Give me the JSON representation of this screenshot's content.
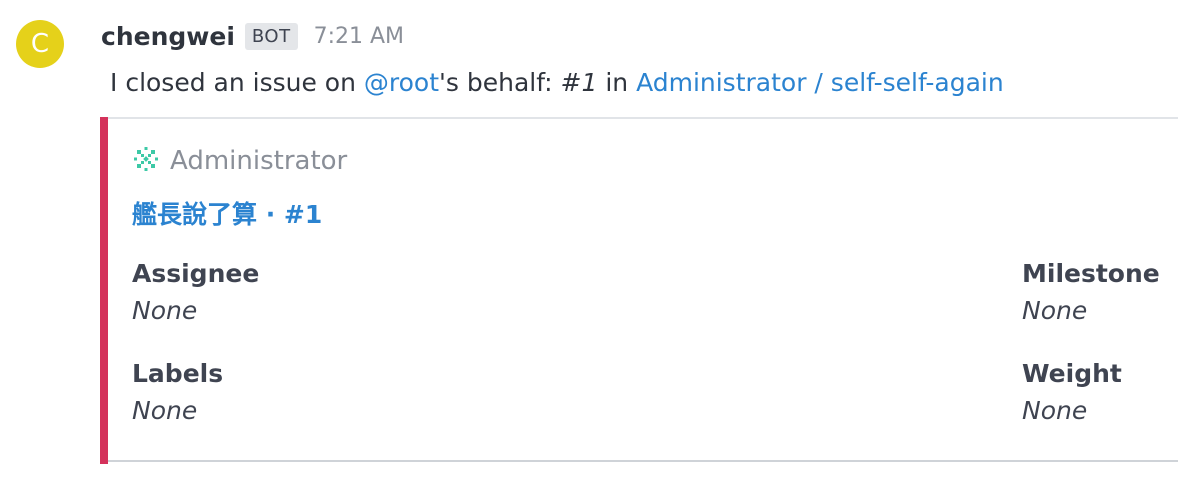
{
  "message": {
    "avatar_letter": "C",
    "avatar_color": "#e5d11a",
    "username": "chengwei",
    "badge": "BOT",
    "time": "7:21 AM",
    "text": {
      "prefix": "I closed an issue on ",
      "mention": "@root",
      "middle": "'s behalf: ",
      "issue_ref": "#1",
      "in_word": " in ",
      "project_link": "Administrator / self-self-again"
    }
  },
  "attachment": {
    "bar_color": "#d4325b",
    "author_icon": "gitlab-snowflake-icon",
    "author": "Administrator",
    "title": "艦長說了算 · #1",
    "fields": [
      {
        "label": "Assignee",
        "value": "None"
      },
      {
        "label": "Milestone",
        "value": "None"
      },
      {
        "label": "Labels",
        "value": "None"
      },
      {
        "label": "Weight",
        "value": "None"
      }
    ]
  },
  "colors": {
    "link": "#2b83d0",
    "text": "#2f343d",
    "muted": "#8a8f98"
  }
}
